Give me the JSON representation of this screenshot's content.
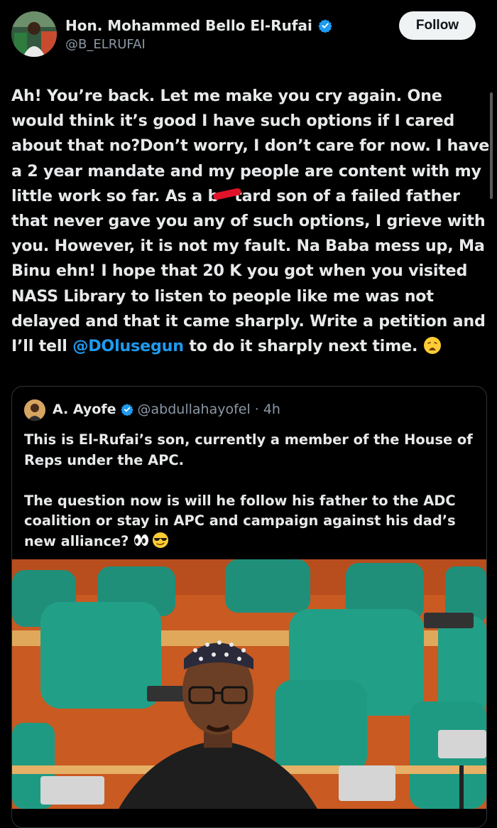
{
  "author": {
    "name": "Hon. Mohammed Bello El-Rufai",
    "handle": "@B_ELRUFAI",
    "verified_icon": "verified-badge-icon",
    "avatar_icon": "user-avatar"
  },
  "follow_label": "Follow",
  "post": {
    "lines": [
      "Ah! You’re back. Let me make you cry again. One",
      "would think it’s good I have such options if I cared",
      "about that no?Don’t worry, I don’t care for now. I have",
      "a 2 year mandate and my people are content with my",
      "little work so far. As a b",
      "tard son of a failed father",
      "that never gave you any of such options, I grieve with",
      "you. However, it is not my fault. Na Baba mess up, Ma",
      "Binu ehn! I hope that 20 K you got when you visited",
      "NASS Library to listen to people like me was not",
      "delayed and that it came sharply. Write a petition and",
      "I’ll tell ",
      "@DOlusegun",
      " to do it sharply next time. "
    ]
  },
  "quote": {
    "name": "A. Ayofe",
    "handle": "@abdullahayofel",
    "time": "· 4h",
    "para1": [
      "This is El-Rufai’s son, currently a member of the House of",
      "Reps under the APC."
    ],
    "para2": [
      "The question now is will he follow his father to the ADC",
      "coalition or stay in APC and campaign against his dad’s",
      "new alliance? "
    ]
  },
  "colors": {
    "background": "#000000",
    "mention": "#1d9bf0",
    "verified": "#1d9bf0",
    "follow_bg": "#eff3f4"
  }
}
